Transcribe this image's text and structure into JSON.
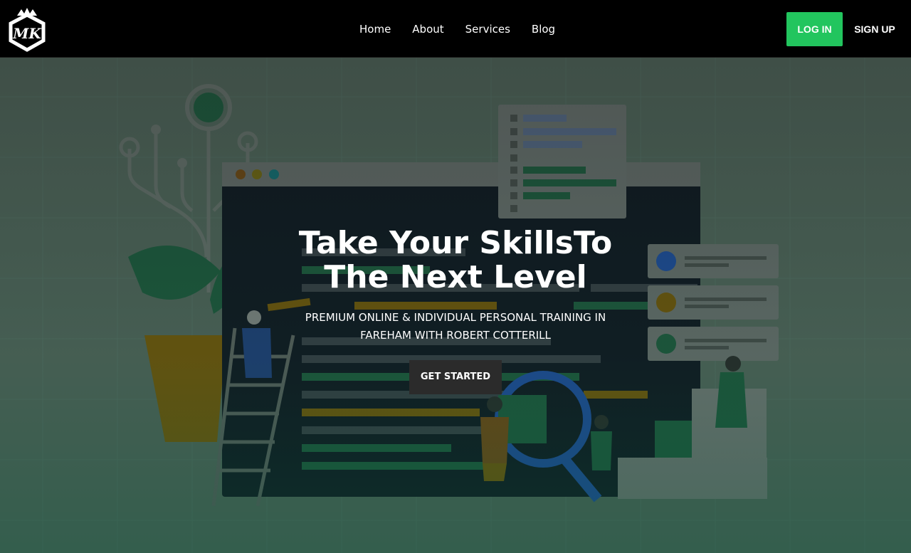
{
  "brand": {
    "logo_icon": "mk-crown-logo-icon",
    "logo_text": "MK"
  },
  "nav": {
    "links": [
      "Home",
      "About",
      "Services",
      "Blog"
    ],
    "login": "LOG IN",
    "signup": "SIGN UP"
  },
  "hero": {
    "title_line1": "Take Your SkillsTo",
    "title_line2": "The Next Level",
    "subtitle": "PREMIUM ONLINE & INDIVIDUAL PERSONAL TRAINING IN FAREHAM WITH ROBERT COTTERILL",
    "cta": "GET STARTED",
    "illustration": "team-building-code-illustration"
  },
  "colors": {
    "accent_green": "#22c55e",
    "nav_bg": "#000000",
    "cta_bg": "#2b2b2b"
  }
}
